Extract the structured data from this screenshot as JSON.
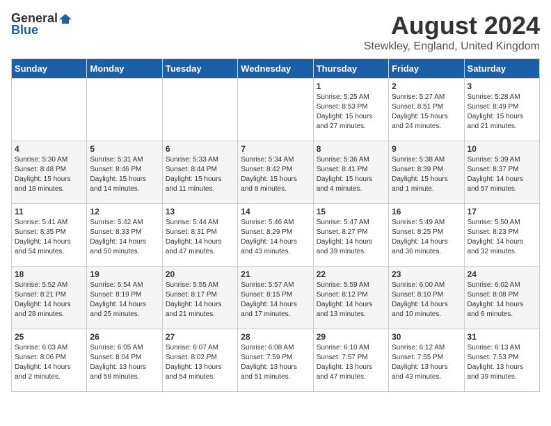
{
  "header": {
    "logo_general": "General",
    "logo_blue": "Blue",
    "month_year": "August 2024",
    "location": "Stewkley, England, United Kingdom"
  },
  "days_of_week": [
    "Sunday",
    "Monday",
    "Tuesday",
    "Wednesday",
    "Thursday",
    "Friday",
    "Saturday"
  ],
  "weeks": [
    [
      {
        "day": "",
        "info": ""
      },
      {
        "day": "",
        "info": ""
      },
      {
        "day": "",
        "info": ""
      },
      {
        "day": "",
        "info": ""
      },
      {
        "day": "1",
        "info": "Sunrise: 5:25 AM\nSunset: 8:53 PM\nDaylight: 15 hours\nand 27 minutes."
      },
      {
        "day": "2",
        "info": "Sunrise: 5:27 AM\nSunset: 8:51 PM\nDaylight: 15 hours\nand 24 minutes."
      },
      {
        "day": "3",
        "info": "Sunrise: 5:28 AM\nSunset: 8:49 PM\nDaylight: 15 hours\nand 21 minutes."
      }
    ],
    [
      {
        "day": "4",
        "info": "Sunrise: 5:30 AM\nSunset: 8:48 PM\nDaylight: 15 hours\nand 18 minutes."
      },
      {
        "day": "5",
        "info": "Sunrise: 5:31 AM\nSunset: 8:46 PM\nDaylight: 15 hours\nand 14 minutes."
      },
      {
        "day": "6",
        "info": "Sunrise: 5:33 AM\nSunset: 8:44 PM\nDaylight: 15 hours\nand 11 minutes."
      },
      {
        "day": "7",
        "info": "Sunrise: 5:34 AM\nSunset: 8:42 PM\nDaylight: 15 hours\nand 8 minutes."
      },
      {
        "day": "8",
        "info": "Sunrise: 5:36 AM\nSunset: 8:41 PM\nDaylight: 15 hours\nand 4 minutes."
      },
      {
        "day": "9",
        "info": "Sunrise: 5:38 AM\nSunset: 8:39 PM\nDaylight: 15 hours\nand 1 minute."
      },
      {
        "day": "10",
        "info": "Sunrise: 5:39 AM\nSunset: 8:37 PM\nDaylight: 14 hours\nand 57 minutes."
      }
    ],
    [
      {
        "day": "11",
        "info": "Sunrise: 5:41 AM\nSunset: 8:35 PM\nDaylight: 14 hours\nand 54 minutes."
      },
      {
        "day": "12",
        "info": "Sunrise: 5:42 AM\nSunset: 8:33 PM\nDaylight: 14 hours\nand 50 minutes."
      },
      {
        "day": "13",
        "info": "Sunrise: 5:44 AM\nSunset: 8:31 PM\nDaylight: 14 hours\nand 47 minutes."
      },
      {
        "day": "14",
        "info": "Sunrise: 5:46 AM\nSunset: 8:29 PM\nDaylight: 14 hours\nand 43 minutes."
      },
      {
        "day": "15",
        "info": "Sunrise: 5:47 AM\nSunset: 8:27 PM\nDaylight: 14 hours\nand 39 minutes."
      },
      {
        "day": "16",
        "info": "Sunrise: 5:49 AM\nSunset: 8:25 PM\nDaylight: 14 hours\nand 36 minutes."
      },
      {
        "day": "17",
        "info": "Sunrise: 5:50 AM\nSunset: 8:23 PM\nDaylight: 14 hours\nand 32 minutes."
      }
    ],
    [
      {
        "day": "18",
        "info": "Sunrise: 5:52 AM\nSunset: 8:21 PM\nDaylight: 14 hours\nand 28 minutes."
      },
      {
        "day": "19",
        "info": "Sunrise: 5:54 AM\nSunset: 8:19 PM\nDaylight: 14 hours\nand 25 minutes."
      },
      {
        "day": "20",
        "info": "Sunrise: 5:55 AM\nSunset: 8:17 PM\nDaylight: 14 hours\nand 21 minutes."
      },
      {
        "day": "21",
        "info": "Sunrise: 5:57 AM\nSunset: 8:15 PM\nDaylight: 14 hours\nand 17 minutes."
      },
      {
        "day": "22",
        "info": "Sunrise: 5:59 AM\nSunset: 8:12 PM\nDaylight: 14 hours\nand 13 minutes."
      },
      {
        "day": "23",
        "info": "Sunrise: 6:00 AM\nSunset: 8:10 PM\nDaylight: 14 hours\nand 10 minutes."
      },
      {
        "day": "24",
        "info": "Sunrise: 6:02 AM\nSunset: 8:08 PM\nDaylight: 14 hours\nand 6 minutes."
      }
    ],
    [
      {
        "day": "25",
        "info": "Sunrise: 6:03 AM\nSunset: 8:06 PM\nDaylight: 14 hours\nand 2 minutes."
      },
      {
        "day": "26",
        "info": "Sunrise: 6:05 AM\nSunset: 8:04 PM\nDaylight: 13 hours\nand 58 minutes."
      },
      {
        "day": "27",
        "info": "Sunrise: 6:07 AM\nSunset: 8:02 PM\nDaylight: 13 hours\nand 54 minutes."
      },
      {
        "day": "28",
        "info": "Sunrise: 6:08 AM\nSunset: 7:59 PM\nDaylight: 13 hours\nand 51 minutes."
      },
      {
        "day": "29",
        "info": "Sunrise: 6:10 AM\nSunset: 7:57 PM\nDaylight: 13 hours\nand 47 minutes."
      },
      {
        "day": "30",
        "info": "Sunrise: 6:12 AM\nSunset: 7:55 PM\nDaylight: 13 hours\nand 43 minutes."
      },
      {
        "day": "31",
        "info": "Sunrise: 6:13 AM\nSunset: 7:53 PM\nDaylight: 13 hours\nand 39 minutes."
      }
    ]
  ]
}
